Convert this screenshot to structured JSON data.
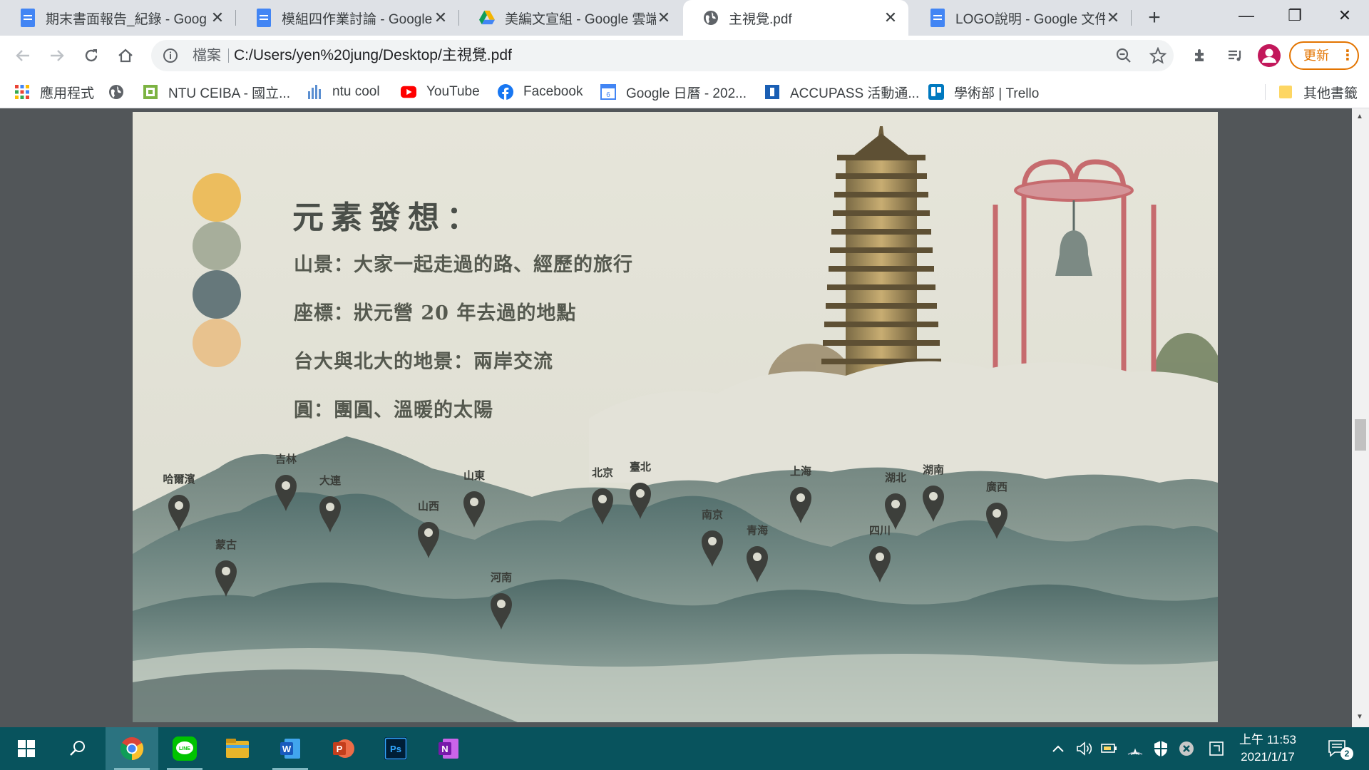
{
  "tabs": [
    {
      "title": "期末書面報告_紀錄 - Goog",
      "icon": "google-docs-icon"
    },
    {
      "title": "模組四作業討論 - Google 文",
      "icon": "google-docs-icon"
    },
    {
      "title": "美編文宣組 - Google 雲端",
      "icon": "google-drive-icon"
    },
    {
      "title": "主視覺.pdf",
      "icon": "globe-icon",
      "active": true
    },
    {
      "title": "LOGO說明 - Google 文件",
      "icon": "google-docs-icon"
    }
  ],
  "new_tab_label": "+",
  "window_controls": {
    "minimize": "—",
    "restore": "❐",
    "close": "✕"
  },
  "omnibox": {
    "security_label": "檔案",
    "url": "C:/Users/yen%20jung/Desktop/主視覺.pdf"
  },
  "update_button": "更新",
  "bookmarks": [
    {
      "label": "應用程式",
      "icon": "apps-grid-icon"
    },
    {
      "label": "",
      "icon": "globe-icon"
    },
    {
      "label": "NTU CEIBA - 國立...",
      "icon": "ceiba-icon"
    },
    {
      "label": "ntu cool",
      "icon": "ntu-cool-icon"
    },
    {
      "label": "YouTube",
      "icon": "youtube-icon"
    },
    {
      "label": "Facebook",
      "icon": "facebook-icon"
    },
    {
      "label": "Google 日曆 - 202...",
      "icon": "google-calendar-icon"
    },
    {
      "label": "ACCUPASS 活動通...",
      "icon": "accupass-icon"
    },
    {
      "label": "學術部 | Trello",
      "icon": "trello-icon"
    }
  ],
  "other_bookmarks": "其他書籤",
  "pdf": {
    "title": "元素發想：",
    "lines": [
      "山景：大家一起走過的路、經歷的旅行",
      "座標：狀元營 20 年去過的地點",
      "台大與北大的地景：兩岸交流",
      "圓：團圓、溫暖的太陽"
    ],
    "palette": [
      "#ecbd5e",
      "#a7ae9b",
      "#66787b",
      "#e8c28e"
    ],
    "map_pins": [
      "哈爾濱",
      "吉林",
      "大連",
      "蒙古",
      "山西",
      "山東",
      "河南",
      "北京",
      "臺北",
      "南京",
      "青海",
      "上海",
      "四川",
      "湖北",
      "湖南",
      "廣西"
    ]
  },
  "taskbar": {
    "apps": [
      "windows-start-icon",
      "search-icon",
      "chrome-icon",
      "line-icon",
      "file-explorer-icon",
      "word-icon",
      "powerpoint-icon",
      "photoshop-icon",
      "onenote-icon"
    ],
    "time": "上午 11:53",
    "date": "2021/1/17",
    "notification_count": "2"
  }
}
